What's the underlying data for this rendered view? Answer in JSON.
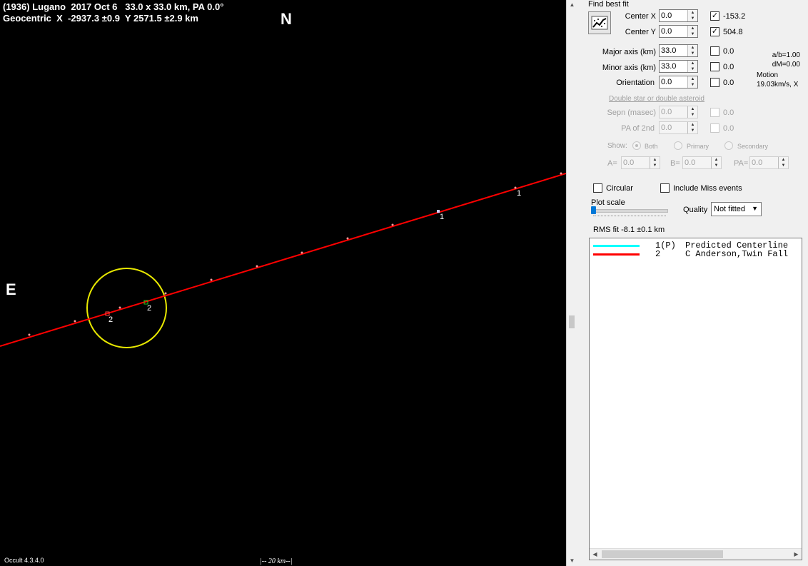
{
  "plot": {
    "title_line1": "(1936) Lugano  2017 Oct 6   33.0 x 33.0 km, PA 0.0°",
    "title_line2": "Geocentric  X  -2937.3 ±0.9  Y 2571.5 ±2.9 km",
    "north_label": "N",
    "east_label": "E",
    "version": "Occult 4.3.4.0",
    "scale_label": "|-- 20 km--|",
    "chord_labels": [
      "1",
      "1",
      "2",
      "2"
    ],
    "colors": {
      "background": "#000000",
      "chord": "#ff0000",
      "ellipse": "#e8e800",
      "centerline": "#00ffff"
    }
  },
  "panel": {
    "find_best_fit": "Find best fit",
    "center_x": {
      "label": "Center X",
      "value": "0.0",
      "checked": true,
      "result": "-153.2"
    },
    "center_y": {
      "label": "Center Y",
      "value": "0.0",
      "checked": true,
      "result": "504.8"
    },
    "major_axis": {
      "label": "Major axis (km)",
      "value": "33.0",
      "checked": false,
      "result": "0.0"
    },
    "minor_axis": {
      "label": "Minor axis (km)",
      "value": "33.0",
      "checked": false,
      "result": "0.0"
    },
    "orientation": {
      "label": "Orientation",
      "value": "0.0",
      "checked": false,
      "result": "0.0"
    },
    "ratio": "a/b=1.00",
    "dm": "dM=0.00",
    "motion_label": "Motion",
    "motion_value": "19.03km/s, X",
    "double_star_link": "Double star  or  double asteroid",
    "sepn": {
      "label": "Sepn (masec)",
      "value": "0.0",
      "result": "0.0"
    },
    "pa2": {
      "label": "PA of 2nd",
      "value": "0.0",
      "result": "0.0"
    },
    "show_label": "Show:",
    "show_options": [
      "Both",
      "Primary",
      "Secondary"
    ],
    "a_field": {
      "label": "A=",
      "value": "0.0"
    },
    "b_field": {
      "label": "B=",
      "value": "0.0"
    },
    "pa_field": {
      "label": "PA=",
      "value": "0.0"
    },
    "circular_label": "Circular",
    "include_miss_label": "Include Miss events",
    "plot_scale_label": "Plot scale",
    "plot_scale_level": 0.0,
    "quality_label": "Quality",
    "quality_value": "Not fitted",
    "rms_fit": "RMS fit -8.1 ±0.1 km",
    "legend": [
      {
        "id": "1(P)",
        "name": "Predicted Centerline",
        "color": "#00ffff"
      },
      {
        "id": "2",
        "name": "C Anderson,Twin Fall",
        "color": "#ff0000"
      }
    ]
  }
}
